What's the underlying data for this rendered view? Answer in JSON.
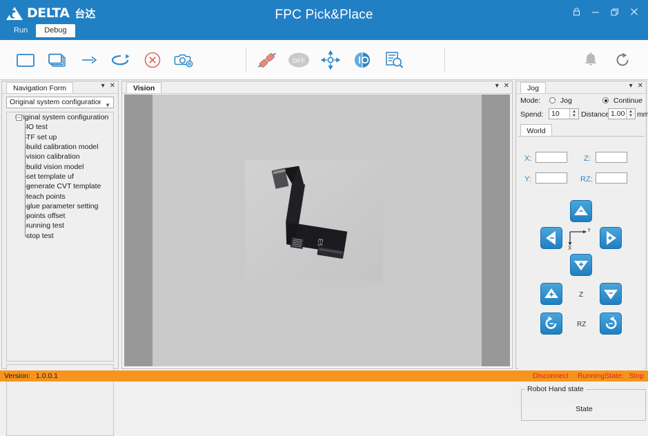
{
  "window": {
    "title": "FPC Pick&Place",
    "controls": [
      {
        "name": "lock-icon",
        "glyph": "\u0001"
      },
      {
        "name": "minimize-icon",
        "glyph": "–"
      },
      {
        "name": "maximize-icon",
        "glyph": "❐"
      },
      {
        "name": "close-icon",
        "glyph": "✕"
      }
    ],
    "brand": {
      "text": "DELTA",
      "cn": "台达"
    }
  },
  "top_tabs": [
    {
      "id": "run",
      "label": "Run",
      "active": false
    },
    {
      "id": "debug",
      "label": "Debug",
      "active": true
    }
  ],
  "toolbar": {
    "group1": [
      {
        "name": "single-window-icon",
        "title": "Single"
      },
      {
        "name": "multi-window-icon",
        "title": "Multi"
      },
      {
        "name": "step-arrow-icon",
        "title": "Step"
      },
      {
        "name": "loop-cycle-icon",
        "title": "Loop"
      },
      {
        "name": "stop-circle-icon",
        "title": "Stop"
      },
      {
        "name": "camera-settings-icon",
        "title": "Camera Settings"
      }
    ],
    "group2": [
      {
        "name": "connect-plug-icon",
        "title": "Connect"
      },
      {
        "name": "power-off-toggle",
        "title": "OFF",
        "label": "OFF"
      },
      {
        "name": "home-axis-icon",
        "title": "Home"
      },
      {
        "name": "io-icon",
        "title": "I/O",
        "label": "I/O"
      },
      {
        "name": "log-search-icon",
        "title": "Log"
      }
    ],
    "group3": [
      {
        "name": "notification-bell-icon",
        "title": "Notifications"
      },
      {
        "name": "refresh-icon",
        "title": "Refresh"
      }
    ]
  },
  "navigation": {
    "tab_label": "Navigation Form",
    "combo_value": "Original system configuration",
    "tree": {
      "root": "Original system configuration",
      "items": [
        "IO test",
        "TF set up",
        "build calibration model",
        "vision calibration",
        "build vision model",
        "set template uf",
        "generate CVT template",
        "teach points",
        "glue parameter setting",
        "points offset",
        "running test",
        "stop test"
      ]
    }
  },
  "vision": {
    "tab_label": "Vision",
    "image_label": "E5"
  },
  "jog": {
    "tab_label": "Jog",
    "mode_label": "Mode:",
    "mode_options": [
      {
        "label": "Jog",
        "selected": false
      },
      {
        "label": "Continue",
        "selected": true
      }
    ],
    "speed_label": "Spend:",
    "speed_value": "10",
    "distance_label": "Distance:",
    "distance_value": "1.00",
    "distance_unit": "mm",
    "coord_tab": "World",
    "coords": [
      {
        "label": "X:",
        "value": ""
      },
      {
        "label": "Z:",
        "value": ""
      },
      {
        "label": "Y:",
        "value": ""
      },
      {
        "label": "RZ:",
        "value": ""
      }
    ],
    "axis_hint": {
      "x": "X",
      "y": "Y"
    },
    "axis_rows": [
      {
        "label": "Z"
      },
      {
        "label": "RZ"
      }
    ],
    "hand_state": {
      "title": "Robot Hand state",
      "state": "State"
    }
  },
  "status_bar": {
    "version_label": "Version:",
    "version_value": "1.0.0.1",
    "connection": "Disconnect",
    "running_state_label": "RunningState:",
    "running_state_value": "Stop"
  },
  "colors": {
    "brand_blue": "#2180c4",
    "status_orange": "#f7941e",
    "status_red": "#d8231a",
    "accent_blue": "#2f86c8"
  }
}
